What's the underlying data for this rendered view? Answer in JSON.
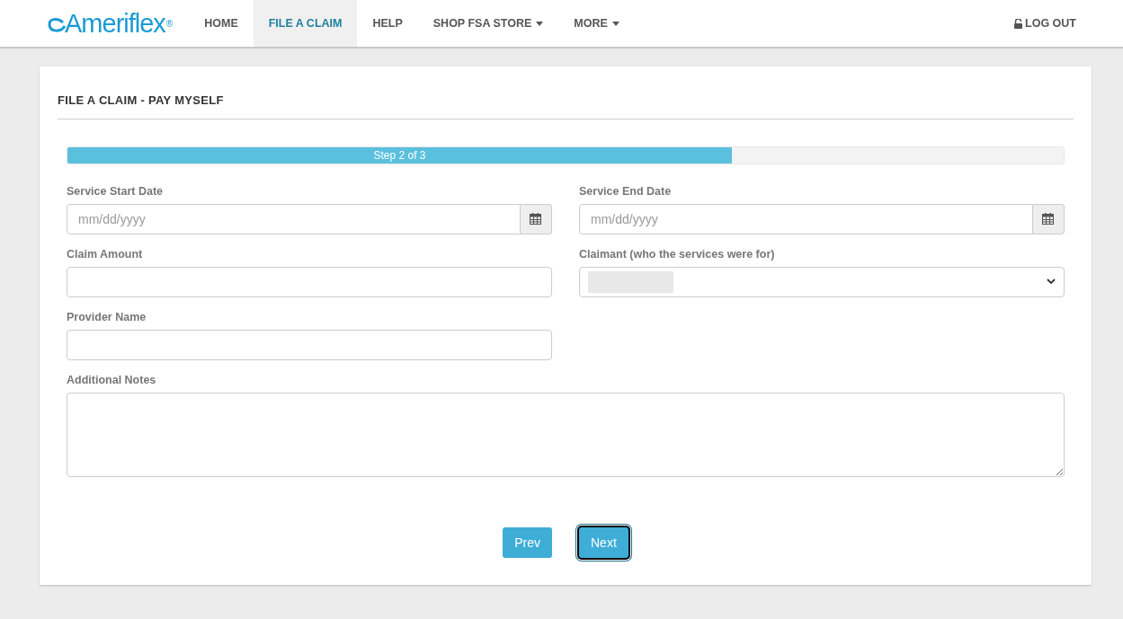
{
  "brand": {
    "name": "Ameriflex",
    "mark": "®"
  },
  "nav": [
    {
      "label": "HOME",
      "selected": false,
      "dropdown": false
    },
    {
      "label": "FILE A CLAIM",
      "selected": true,
      "dropdown": false
    },
    {
      "label": "HELP",
      "selected": false,
      "dropdown": false
    },
    {
      "label": "SHOP FSA STORE",
      "selected": false,
      "dropdown": true
    },
    {
      "label": "MORE",
      "selected": false,
      "dropdown": true
    }
  ],
  "logout": "LOG OUT",
  "panel": {
    "title": "FILE A CLAIM - PAY MYSELF"
  },
  "progress": {
    "label": "Step 2 of 3",
    "level": 0.667
  },
  "fields": [
    {
      "kind": "date",
      "label": "Service Start Date",
      "placeholder": "mm/dd/yyyy"
    },
    {
      "kind": "date",
      "label": "Service End Date",
      "placeholder": "mm/dd/yyyy"
    },
    {
      "kind": "text",
      "label": "Claim Amount"
    },
    {
      "kind": "select",
      "label": "Claimant (who the services were for)",
      "redacted": true
    },
    {
      "kind": "text",
      "label": "Provider Name"
    },
    {
      "kind": "textarea",
      "label": "Additional Notes"
    }
  ],
  "buttons": [
    {
      "label": "Prev",
      "focused": false
    },
    {
      "label": "Next",
      "focused": true
    }
  ]
}
